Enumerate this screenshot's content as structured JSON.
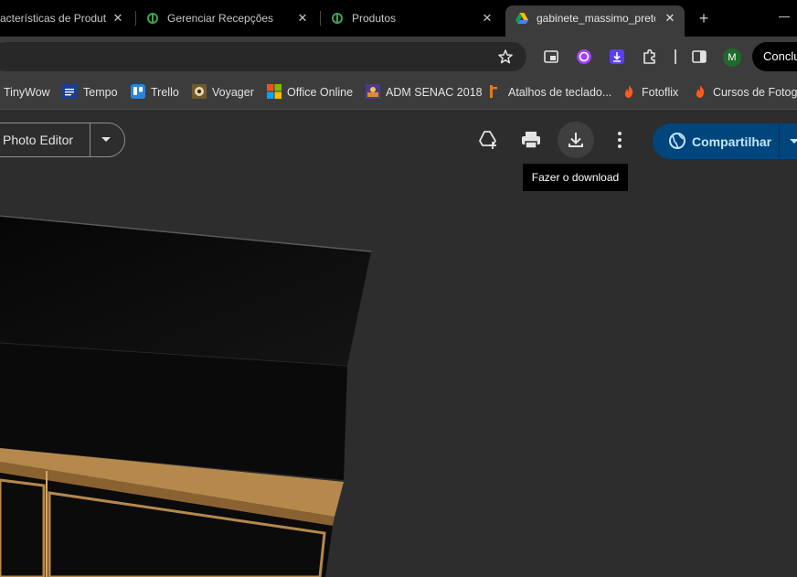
{
  "tabs": [
    {
      "title": "acterísticas de Produt",
      "close": "✕"
    },
    {
      "title": "Gerenciar Recepções",
      "close": "✕"
    },
    {
      "title": "Produtos",
      "close": "✕"
    },
    {
      "title": "gabinete_massimo_preto",
      "close": "✕"
    }
  ],
  "new_tab": "+",
  "profile_initial": "M",
  "update_button": "Concluir",
  "bookmarks": [
    {
      "label": "TinyWow"
    },
    {
      "label": "Tempo"
    },
    {
      "label": "Trello"
    },
    {
      "label": "Voyager"
    },
    {
      "label": "Office Online"
    },
    {
      "label": "ADM SENAC 2018"
    },
    {
      "label": "Atalhos de teclado..."
    },
    {
      "label": "Fotoflix"
    },
    {
      "label": "Cursos de Fotografia"
    }
  ],
  "viewer": {
    "open_with_label": "Photo Editor",
    "tooltip": "Fazer o download",
    "share_label": "Compartilhar"
  },
  "colors": {
    "share_bg": "#00457c",
    "share_text": "#c2e7ff",
    "chrome_dark": "#3c3c3c"
  }
}
